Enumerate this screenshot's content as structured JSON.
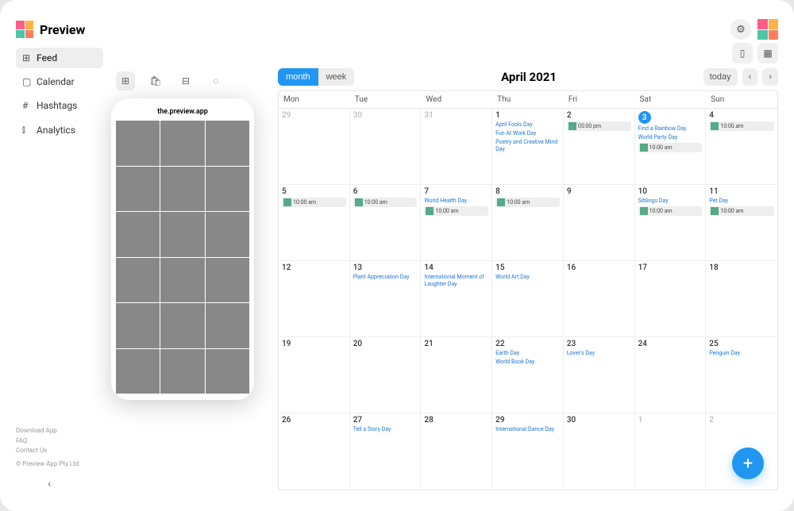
{
  "app": {
    "title": "Preview"
  },
  "sidebar": {
    "items": [
      {
        "label": "Feed",
        "icon": "⊞"
      },
      {
        "label": "Calendar",
        "icon": "▢"
      },
      {
        "label": "Hashtags",
        "icon": "#"
      },
      {
        "label": "Analytics",
        "icon": "⫾"
      }
    ]
  },
  "footer": {
    "links": [
      "Download App",
      "FAQ",
      "Contact Us"
    ],
    "copyright": "© Preview App Pty Ltd"
  },
  "phone": {
    "handle": "the.preview.app"
  },
  "viewToggle": {
    "month": "month",
    "week": "week"
  },
  "calendar": {
    "title": "April 2021",
    "today": "today",
    "dayHeads": [
      "Mon",
      "Tue",
      "Wed",
      "Thu",
      "Fri",
      "Sat",
      "Sun"
    ],
    "weeks": [
      [
        {
          "n": "29",
          "dim": true
        },
        {
          "n": "30",
          "dim": true
        },
        {
          "n": "31",
          "dim": true
        },
        {
          "n": "1",
          "events": [
            {
              "t": "text",
              "label": "April Fools Day"
            },
            {
              "t": "text",
              "label": "Fun At Work Day"
            },
            {
              "t": "text",
              "label": "Poetry and Creative Mind Day"
            }
          ]
        },
        {
          "n": "2",
          "events": [
            {
              "t": "chip",
              "time": "05:00 pm"
            }
          ]
        },
        {
          "n": "3",
          "today": true,
          "events": [
            {
              "t": "text",
              "label": "Find a Rainbow Day"
            },
            {
              "t": "text",
              "label": "World Party Day"
            },
            {
              "t": "chip",
              "time": "10:00 am"
            }
          ]
        },
        {
          "n": "4",
          "events": [
            {
              "t": "chip",
              "time": "10:00 am"
            }
          ]
        }
      ],
      [
        {
          "n": "5",
          "events": [
            {
              "t": "chip",
              "time": "10:00 am"
            }
          ]
        },
        {
          "n": "6",
          "events": [
            {
              "t": "chip",
              "time": "10:00 am"
            }
          ]
        },
        {
          "n": "7",
          "events": [
            {
              "t": "text",
              "label": "World Health Day"
            },
            {
              "t": "chip",
              "time": "10:00 am"
            }
          ]
        },
        {
          "n": "8",
          "events": [
            {
              "t": "chip",
              "time": "10:00 am"
            }
          ]
        },
        {
          "n": "9"
        },
        {
          "n": "10",
          "events": [
            {
              "t": "text",
              "label": "Siblings Day"
            },
            {
              "t": "chip",
              "time": "10:00 am"
            }
          ]
        },
        {
          "n": "11",
          "events": [
            {
              "t": "text",
              "label": "Pet Day"
            },
            {
              "t": "chip",
              "time": "10:00 am"
            }
          ]
        }
      ],
      [
        {
          "n": "12"
        },
        {
          "n": "13",
          "events": [
            {
              "t": "text",
              "label": "Plant Appreciation Day"
            }
          ]
        },
        {
          "n": "14",
          "events": [
            {
              "t": "text",
              "label": "International Moment of Laughter Day"
            }
          ]
        },
        {
          "n": "15",
          "events": [
            {
              "t": "text",
              "label": "World Art Day"
            }
          ]
        },
        {
          "n": "16"
        },
        {
          "n": "17"
        },
        {
          "n": "18"
        }
      ],
      [
        {
          "n": "19"
        },
        {
          "n": "20"
        },
        {
          "n": "21"
        },
        {
          "n": "22",
          "events": [
            {
              "t": "text",
              "label": "Earth Day"
            },
            {
              "t": "text",
              "label": "World Book Day"
            }
          ]
        },
        {
          "n": "23",
          "events": [
            {
              "t": "text",
              "label": "Lover's Day"
            }
          ]
        },
        {
          "n": "24"
        },
        {
          "n": "25",
          "events": [
            {
              "t": "text",
              "label": "Penguin Day"
            }
          ]
        }
      ],
      [
        {
          "n": "26"
        },
        {
          "n": "27",
          "events": [
            {
              "t": "text",
              "label": "Tell a Story Day"
            }
          ]
        },
        {
          "n": "28"
        },
        {
          "n": "29",
          "events": [
            {
              "t": "text",
              "label": "International Dance Day"
            }
          ]
        },
        {
          "n": "30"
        },
        {
          "n": "1",
          "dim": true
        },
        {
          "n": "2",
          "dim": true
        }
      ]
    ]
  }
}
